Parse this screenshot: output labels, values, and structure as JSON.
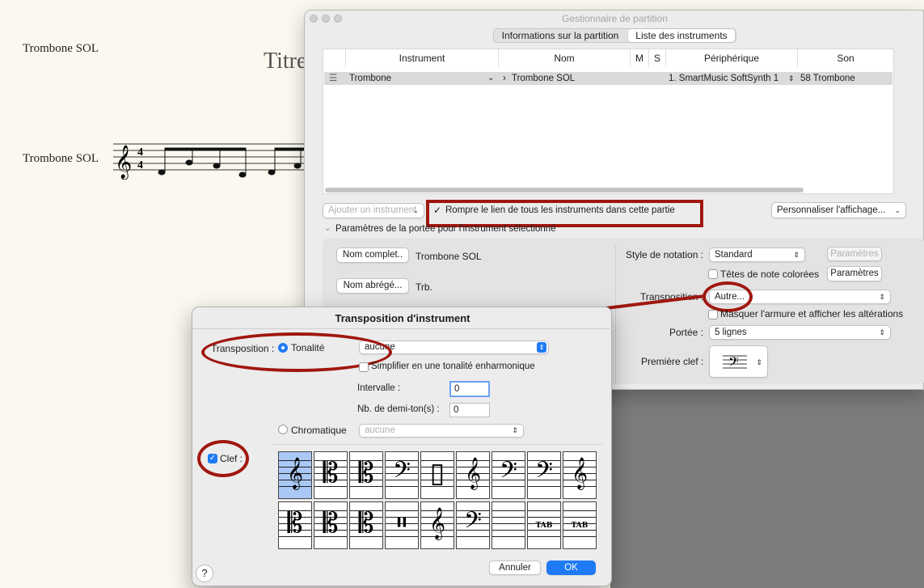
{
  "score": {
    "staff_label_top": "Trombone SOL",
    "staff_label": "Trombone SOL",
    "title_fragment": "Titre",
    "time_sig": "4"
  },
  "manager": {
    "title": "Gestionnaire de partition",
    "tabs": [
      "Informations sur la partition",
      "Liste des instruments"
    ],
    "active_tab": "Liste des instruments",
    "columns": [
      "Instrument",
      "Nom",
      "M",
      "S",
      "Périphérique",
      "Son"
    ],
    "rows": [
      {
        "instrument": "Trombone",
        "nom": "Trombone SOL",
        "peripherique": "1. SmartMusic SoftSynth 1",
        "son": "58 Trombone"
      }
    ],
    "add_instrument": "Ajouter un instrument",
    "break_link_label": "Rompre le lien de tous les instruments dans cette partie",
    "customize_button": "Personnaliser l'affichage...",
    "section_title": "Paramètres de la portée pour l'instrument sélectionné",
    "full_name_button": "Nom complet..",
    "full_name_value": "Trombone SOL",
    "short_name_button": "Nom abrégé...",
    "short_name_value": "Trb.",
    "notation_style_label": "Style de notation :",
    "notation_style_value": "Standard",
    "params_button_disabled": "Paramètres",
    "colored_heads_label": "Têtes de note colorées",
    "params_button": "Paramètres",
    "transposition_label": "Transposition :",
    "transposition_value": "Autre...",
    "hide_key_label": "Masquer l'armure et afficher les altérations",
    "staff_label": "Portée :",
    "staff_value": "5 lignes",
    "first_clef_label": "Première clef :"
  },
  "dialog": {
    "title": "Transposition d'instrument",
    "transposition_label": "Transposition :",
    "tonality_label": "Tonalité",
    "tonality_value": "aucune",
    "simplify_label": "Simplifier en une tonalité enharmonique",
    "interval_label": "Intervalle :",
    "interval_value": "0",
    "semitones_label": "Nb. de demi-ton(s) :",
    "semitones_value": "0",
    "chromatic_label": "Chromatique",
    "chromatic_value": "aucune",
    "clef_label": "Clef :",
    "clef_checked": true,
    "clefs_row1": [
      "𝄞",
      "𝄡",
      "𝄡",
      "𝄢",
      "▯",
      "𝄞",
      "𝄢",
      "𝄢",
      "𝄞"
    ],
    "clefs_row2": [
      "𝄡",
      "𝄡",
      "𝄡",
      "𝄥",
      "𝄞",
      "𝄢",
      "",
      "TAB",
      "TAB"
    ],
    "selected_clef_index": 0,
    "cancel_button": "Annuler",
    "ok_button": "OK",
    "help": "?"
  },
  "colors": {
    "annotation_red": "#a0170f",
    "accent_blue": "#1f7af5"
  }
}
